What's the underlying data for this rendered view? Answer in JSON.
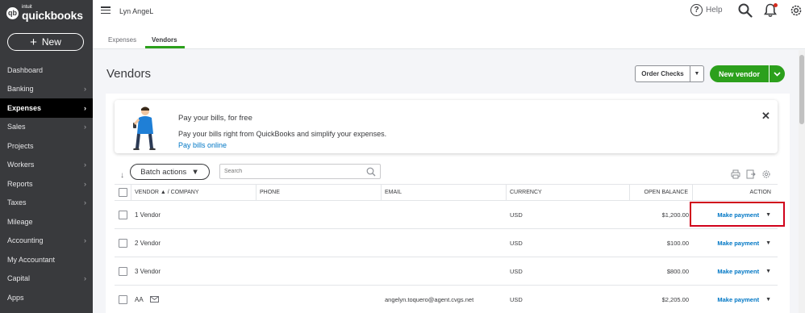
{
  "sidebar": {
    "logo_intuit": "intuit",
    "logo_name": "quickbooks",
    "new_label": "New",
    "items": [
      {
        "label": "Dashboard",
        "chev": ""
      },
      {
        "label": "Banking",
        "chev": "›"
      },
      {
        "label": "Expenses",
        "chev": "›"
      },
      {
        "label": "Sales",
        "chev": "›"
      },
      {
        "label": "Projects",
        "chev": ""
      },
      {
        "label": "Workers",
        "chev": "›"
      },
      {
        "label": "Reports",
        "chev": "›"
      },
      {
        "label": "Taxes",
        "chev": "›"
      },
      {
        "label": "Mileage",
        "chev": ""
      },
      {
        "label": "Accounting",
        "chev": "›"
      },
      {
        "label": "My Accountant",
        "chev": ""
      },
      {
        "label": "Capital",
        "chev": "›"
      },
      {
        "label": "Apps",
        "chev": ""
      }
    ]
  },
  "header": {
    "company": "Lyn AngeL",
    "help_label": "Help"
  },
  "tabs": [
    {
      "label": "Expenses"
    },
    {
      "label": "Vendors"
    }
  ],
  "page": {
    "title": "Vendors",
    "order_checks": "Order Checks",
    "new_vendor": "New vendor"
  },
  "promo": {
    "title": "Pay your bills, for free",
    "text": "Pay your bills right from QuickBooks and simplify your expenses.",
    "link": "Pay bills online"
  },
  "toolbar": {
    "batch_actions": "Batch actions",
    "search_placeholder": "Search"
  },
  "table": {
    "headers": {
      "vendor": "VENDOR ▲ / COMPANY",
      "phone": "PHONE",
      "email": "EMAIL",
      "currency": "CURRENCY",
      "balance": "OPEN BALANCE",
      "action": "ACTION"
    },
    "rows": [
      {
        "vendor": "1 Vendor",
        "phone": "",
        "email": "",
        "currency": "USD",
        "balance": "$1,200.00",
        "action": "Make payment"
      },
      {
        "vendor": "2 Vendor",
        "phone": "",
        "email": "",
        "currency": "USD",
        "balance": "$100.00",
        "action": "Make payment"
      },
      {
        "vendor": "3 Vendor",
        "phone": "",
        "email": "",
        "currency": "USD",
        "balance": "$800.00",
        "action": "Make payment"
      },
      {
        "vendor": "AA",
        "phone": "",
        "email": "angelyn.toquero@agent.cvgs.net",
        "currency": "USD",
        "balance": "$2,205.00",
        "action": "Make payment"
      }
    ]
  },
  "colors": {
    "brand_green": "#2ca01c",
    "link_blue": "#0077c5",
    "sidebar_bg": "#393a3d",
    "highlight_red": "#d0021b"
  }
}
